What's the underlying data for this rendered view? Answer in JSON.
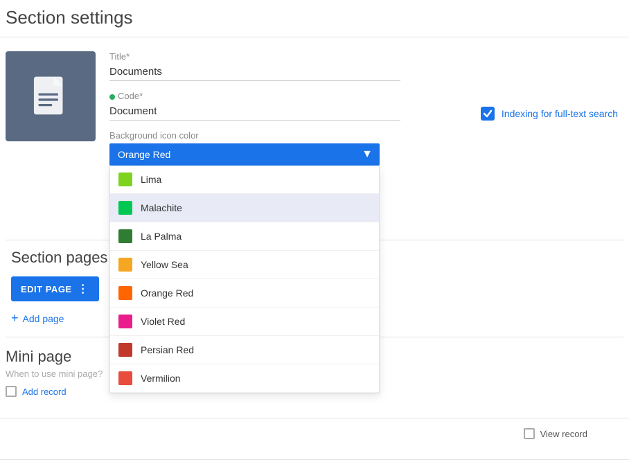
{
  "page": {
    "title": "Section settings"
  },
  "form": {
    "title_label": "Title*",
    "title_value": "Documents",
    "code_label": "Code*",
    "code_value": "Document",
    "bg_color_label": "Background icon color"
  },
  "dropdown": {
    "selected": "Orange Red",
    "items": [
      {
        "name": "Lima",
        "color": "#7ed321",
        "highlighted": false
      },
      {
        "name": "Malachite",
        "color": "#00c853",
        "highlighted": true
      },
      {
        "name": "La Palma",
        "color": "#2e7d32",
        "highlighted": false
      },
      {
        "name": "Yellow Sea",
        "color": "#f5a623",
        "highlighted": false
      },
      {
        "name": "Orange Red",
        "color": "#ff6600",
        "highlighted": false
      },
      {
        "name": "Violet Red",
        "color": "#e91e8c",
        "highlighted": false
      },
      {
        "name": "Persian Red",
        "color": "#c0392b",
        "highlighted": false
      },
      {
        "name": "Vermilion",
        "color": "#e74c3c",
        "highlighted": false
      }
    ]
  },
  "indexing": {
    "label": "Indexing for full-text search",
    "checked": true
  },
  "section_pages": {
    "title": "Section pages",
    "edit_button": "EDIT PAGE",
    "add_page": "Add page"
  },
  "mini_page": {
    "title": "Mini page",
    "subtitle": "When to use mini page?",
    "add_record": "Add record",
    "view_record": "View record"
  },
  "colors": {
    "Lima": "#7ed321",
    "Malachite": "#00c853",
    "La Palma": "#2e7d32",
    "Yellow Sea": "#f5a623",
    "Orange Red": "#ff6600",
    "Violet Red": "#e91e8c",
    "Persian Red": "#c0392b",
    "Vermilion": "#e74c3c"
  }
}
